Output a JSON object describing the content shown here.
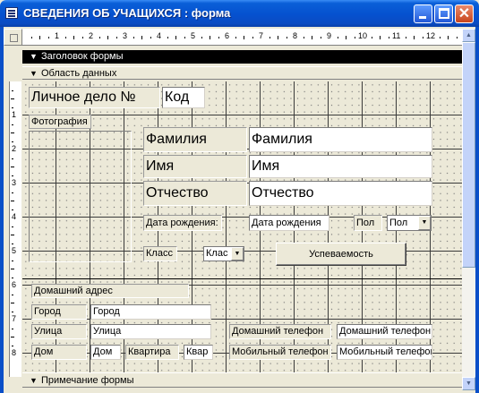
{
  "window": {
    "title": "СВЕДЕНИЯ ОБ УЧАЩИХСЯ : форма",
    "controls": {
      "minimize": "_",
      "maximize": "□",
      "close": "✕"
    }
  },
  "ruler": {
    "numbers": [
      "1",
      "2",
      "3",
      "4",
      "5",
      "6",
      "7",
      "8",
      "9",
      "10",
      "11",
      "12"
    ],
    "vertical_numbers": [
      "1",
      "2",
      "3",
      "4",
      "5",
      "6",
      "7",
      "8"
    ]
  },
  "sections": {
    "header": "Заголовок формы",
    "detail": "Область данных",
    "footer": "Примечание формы"
  },
  "form": {
    "personal_file_label": "Личное дело №",
    "personal_file_field": "Код",
    "photo_label": "Фотография",
    "surname_label": "Фамилия",
    "surname_field": "Фамилия",
    "name_label": "Имя",
    "name_field": "Имя",
    "patronymic_label": "Отчество",
    "patronymic_field": "Отчество",
    "birth_label": "Дата рождения:",
    "birth_field": "Дата рождения",
    "gender_label": "Пол",
    "gender_field": "Пол",
    "class_label": "Класс",
    "class_field": "Клас",
    "performance_button": "Успеваемость",
    "home_address_label": "Домашний адрес",
    "city_label": "Город",
    "city_field": "Город",
    "street_label": "Улица",
    "street_field": "Улица",
    "house_label": "Дом",
    "house_field": "Дом",
    "apartment_label": "Квартира",
    "apartment_field": "Квар",
    "home_phone_label": "Домашний телефон",
    "home_phone_field": "Домашний телефон",
    "mobile_phone_label": "Мобильный телефон",
    "mobile_phone_field": "Мобильный телефон"
  },
  "scroll": {
    "up": "▲",
    "down": "▼",
    "dropdown": "▼"
  },
  "colors": {
    "titlebar": "#0551cf",
    "section_bar": "#000000",
    "background": "#ece9d8"
  }
}
